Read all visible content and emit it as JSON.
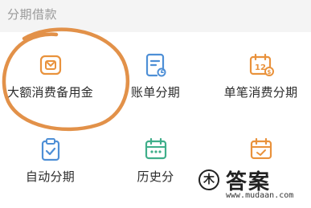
{
  "section": {
    "title": "分期借款"
  },
  "items": [
    {
      "label": "大额消费备用金",
      "icon": "wallet-icon"
    },
    {
      "label": "账单分期",
      "icon": "bill-document-icon"
    },
    {
      "label": "单笔消费分期",
      "icon": "calendar-12-icon"
    },
    {
      "label": "自动分期",
      "icon": "clipboard-check-icon"
    },
    {
      "label": "历史分",
      "icon": "calendar-green-icon"
    },
    {
      "label": "",
      "icon": "calendar-orange-icon"
    }
  ],
  "annotation": {
    "circle_color": "#e0883a"
  },
  "watermark": {
    "logo_text": "木",
    "name": "答案",
    "url": "www.mudaan.com"
  },
  "colors": {
    "accent_orange": "#e9923c",
    "accent_blue": "#4e8fd6",
    "accent_green": "#3fae8a"
  }
}
